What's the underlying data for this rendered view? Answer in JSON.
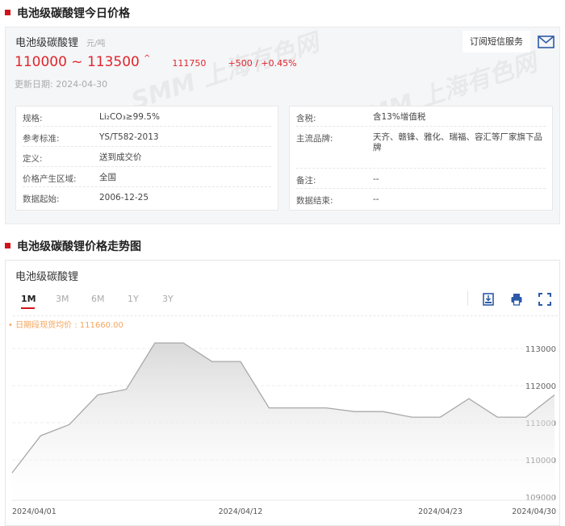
{
  "today": {
    "section_title": "电池级碳酸锂今日价格",
    "product": "电池级碳酸锂",
    "unit": "元/吨",
    "price_range": "110000 ~ 113500",
    "trend_icon": "up-arrow-icon",
    "average": "111750",
    "change": "+500 / +0.45%",
    "updated": "更新日期: 2024-04-30",
    "subscribe_label": "订阅短信服务",
    "left_rows": [
      {
        "label": "规格:",
        "value": "Li₂CO₃≥99.5%"
      },
      {
        "label": "参考标准:",
        "value": "YS/T582-2013"
      },
      {
        "label": "定义:",
        "value": "送到成交价"
      },
      {
        "label": "价格产生区域:",
        "value": "全国"
      },
      {
        "label": "数据起始:",
        "value": "2006-12-25"
      }
    ],
    "right_rows": [
      {
        "label": "含税:",
        "value": "含13%增值税"
      },
      {
        "label": "主流品牌:",
        "value": "天齐、赣锋、雅化、瑞福、容汇等厂家旗下品牌"
      },
      {
        "label": "备注:",
        "value": "--"
      },
      {
        "label": "数据结束:",
        "value": "--"
      }
    ],
    "watermark": "SMM 上海有色网"
  },
  "trend": {
    "section_title": "电池级碳酸锂价格走势图",
    "chart_title": "电池级碳酸锂",
    "tabs": [
      "1M",
      "3M",
      "6M",
      "1Y",
      "3Y"
    ],
    "active_tab": "1M",
    "avg_label": "• 日期段现货均价 : 111660.00",
    "accent": "#d0141b",
    "avg_color": "#f5a55c"
  },
  "chart_data": {
    "type": "area",
    "title": "电池级碳酸锂",
    "xlabel": "",
    "ylabel": "",
    "x": [
      "2024/04/01",
      "2024/04/02",
      "2024/04/03",
      "2024/04/07",
      "2024/04/08",
      "2024/04/09",
      "2024/04/10",
      "2024/04/11",
      "2024/04/12",
      "2024/04/15",
      "2024/04/16",
      "2024/04/17",
      "2024/04/18",
      "2024/04/19",
      "2024/04/22",
      "2024/04/23",
      "2024/04/24",
      "2024/04/25",
      "2024/04/26",
      "2024/04/29",
      "2024/04/30"
    ],
    "values": [
      109650,
      110650,
      110950,
      111750,
      111900,
      113150,
      113150,
      112650,
      112650,
      111400,
      111400,
      111400,
      111300,
      111300,
      111150,
      111150,
      111650,
      111150,
      111150,
      111750
    ],
    "x_ticks": [
      "2024/04/01",
      "2024/04/12",
      "2024/04/23",
      "2024/04/30"
    ],
    "y_ticks": [
      109000,
      110000,
      111000,
      112000,
      113000
    ],
    "ylim": [
      109000,
      113300
    ],
    "grid": true
  }
}
